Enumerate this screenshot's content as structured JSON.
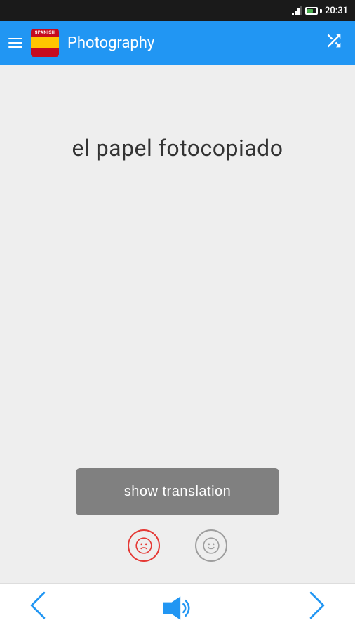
{
  "statusBar": {
    "time": "20:31"
  },
  "appBar": {
    "title": "Photography",
    "flagLabel": "SPANISH",
    "shuffleLabel": "shuffle"
  },
  "main": {
    "word": "el papel fotocopiado",
    "showTranslationLabel": "show translation",
    "sadFaceLabel": "sad face",
    "happyFaceLabel": "happy face"
  },
  "bottomNav": {
    "previousLabel": "<",
    "speakerLabel": "speaker",
    "nextLabel": ">"
  },
  "colors": {
    "appBar": "#2196F3",
    "statusBar": "#1a1a1a",
    "accent": "#2196F3",
    "sadColor": "#e53935",
    "happyColor": "#9e9e9e",
    "buttonBg": "#808080"
  }
}
